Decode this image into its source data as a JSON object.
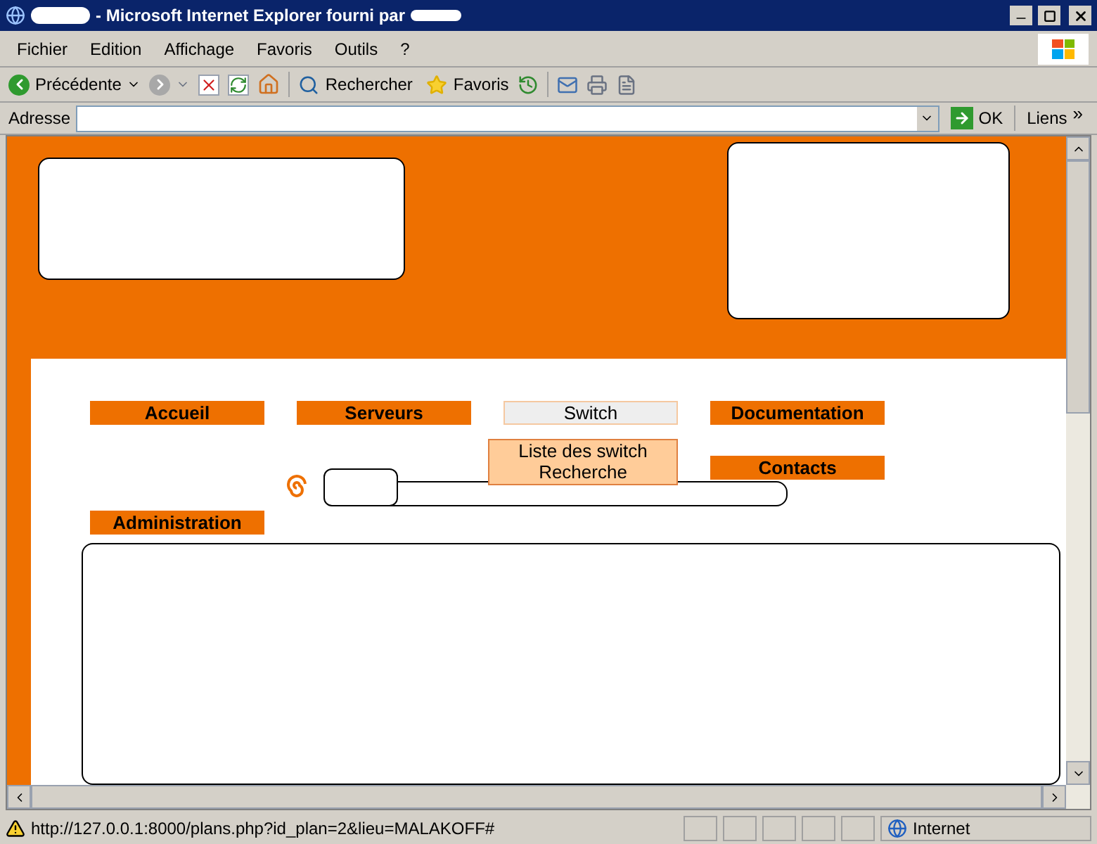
{
  "window": {
    "title": "- Microsoft Internet Explorer fourni par"
  },
  "menu": [
    "Fichier",
    "Edition",
    "Affichage",
    "Favoris",
    "Outils",
    "?"
  ],
  "toolbar": {
    "back": "Précédente",
    "search": "Rechercher",
    "favorites": "Favoris"
  },
  "address": {
    "label": "Adresse",
    "go": "OK",
    "links": "Liens",
    "more": "»"
  },
  "nav": [
    {
      "label": "Accueil",
      "selected": false
    },
    {
      "label": "Serveurs",
      "selected": false
    },
    {
      "label": "Switch",
      "selected": true
    },
    {
      "label": "Documentation",
      "selected": false
    },
    {
      "label": "Contacts",
      "selected": false
    },
    {
      "label": "Administration",
      "selected": false
    }
  ],
  "submenu": [
    "Liste des switch",
    "Recherche"
  ],
  "status_bar": {
    "url": "http://127.0.0.1:8000/plans.php?id_plan=2&lieu=MALAKOFF#",
    "zone": "Internet"
  }
}
